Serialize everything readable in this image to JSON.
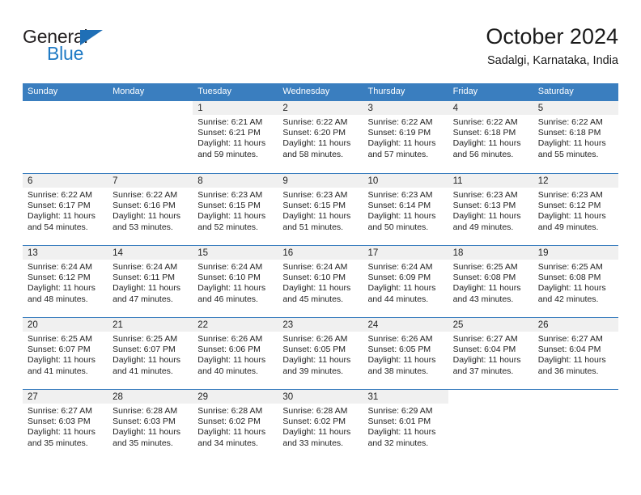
{
  "logo": {
    "word_top": "General",
    "word_bottom": "Blue",
    "triangle_icon": "triangle-icon",
    "color_dark": "#231f20",
    "color_blue": "#1f7ac4"
  },
  "header": {
    "title": "October 2024",
    "subtitle": "Sadalgi, Karnataka, India"
  },
  "theme": {
    "header_blue": "#3a7ebf",
    "daynum_gray": "#f0f0f0",
    "text": "#222222"
  },
  "calendar": {
    "weekdays": [
      "Sunday",
      "Monday",
      "Tuesday",
      "Wednesday",
      "Thursday",
      "Friday",
      "Saturday"
    ],
    "weeks": [
      [
        {
          "day": "",
          "sunrise": "",
          "sunset": "",
          "daylight1": "",
          "daylight2": "",
          "blank": true
        },
        {
          "day": "",
          "sunrise": "",
          "sunset": "",
          "daylight1": "",
          "daylight2": "",
          "blank": true
        },
        {
          "day": "1",
          "sunrise": "Sunrise: 6:21 AM",
          "sunset": "Sunset: 6:21 PM",
          "daylight1": "Daylight: 11 hours",
          "daylight2": "and 59 minutes."
        },
        {
          "day": "2",
          "sunrise": "Sunrise: 6:22 AM",
          "sunset": "Sunset: 6:20 PM",
          "daylight1": "Daylight: 11 hours",
          "daylight2": "and 58 minutes."
        },
        {
          "day": "3",
          "sunrise": "Sunrise: 6:22 AM",
          "sunset": "Sunset: 6:19 PM",
          "daylight1": "Daylight: 11 hours",
          "daylight2": "and 57 minutes."
        },
        {
          "day": "4",
          "sunrise": "Sunrise: 6:22 AM",
          "sunset": "Sunset: 6:18 PM",
          "daylight1": "Daylight: 11 hours",
          "daylight2": "and 56 minutes."
        },
        {
          "day": "5",
          "sunrise": "Sunrise: 6:22 AM",
          "sunset": "Sunset: 6:18 PM",
          "daylight1": "Daylight: 11 hours",
          "daylight2": "and 55 minutes."
        }
      ],
      [
        {
          "day": "6",
          "sunrise": "Sunrise: 6:22 AM",
          "sunset": "Sunset: 6:17 PM",
          "daylight1": "Daylight: 11 hours",
          "daylight2": "and 54 minutes."
        },
        {
          "day": "7",
          "sunrise": "Sunrise: 6:22 AM",
          "sunset": "Sunset: 6:16 PM",
          "daylight1": "Daylight: 11 hours",
          "daylight2": "and 53 minutes."
        },
        {
          "day": "8",
          "sunrise": "Sunrise: 6:23 AM",
          "sunset": "Sunset: 6:15 PM",
          "daylight1": "Daylight: 11 hours",
          "daylight2": "and 52 minutes."
        },
        {
          "day": "9",
          "sunrise": "Sunrise: 6:23 AM",
          "sunset": "Sunset: 6:15 PM",
          "daylight1": "Daylight: 11 hours",
          "daylight2": "and 51 minutes."
        },
        {
          "day": "10",
          "sunrise": "Sunrise: 6:23 AM",
          "sunset": "Sunset: 6:14 PM",
          "daylight1": "Daylight: 11 hours",
          "daylight2": "and 50 minutes."
        },
        {
          "day": "11",
          "sunrise": "Sunrise: 6:23 AM",
          "sunset": "Sunset: 6:13 PM",
          "daylight1": "Daylight: 11 hours",
          "daylight2": "and 49 minutes."
        },
        {
          "day": "12",
          "sunrise": "Sunrise: 6:23 AM",
          "sunset": "Sunset: 6:12 PM",
          "daylight1": "Daylight: 11 hours",
          "daylight2": "and 49 minutes."
        }
      ],
      [
        {
          "day": "13",
          "sunrise": "Sunrise: 6:24 AM",
          "sunset": "Sunset: 6:12 PM",
          "daylight1": "Daylight: 11 hours",
          "daylight2": "and 48 minutes."
        },
        {
          "day": "14",
          "sunrise": "Sunrise: 6:24 AM",
          "sunset": "Sunset: 6:11 PM",
          "daylight1": "Daylight: 11 hours",
          "daylight2": "and 47 minutes."
        },
        {
          "day": "15",
          "sunrise": "Sunrise: 6:24 AM",
          "sunset": "Sunset: 6:10 PM",
          "daylight1": "Daylight: 11 hours",
          "daylight2": "and 46 minutes."
        },
        {
          "day": "16",
          "sunrise": "Sunrise: 6:24 AM",
          "sunset": "Sunset: 6:10 PM",
          "daylight1": "Daylight: 11 hours",
          "daylight2": "and 45 minutes."
        },
        {
          "day": "17",
          "sunrise": "Sunrise: 6:24 AM",
          "sunset": "Sunset: 6:09 PM",
          "daylight1": "Daylight: 11 hours",
          "daylight2": "and 44 minutes."
        },
        {
          "day": "18",
          "sunrise": "Sunrise: 6:25 AM",
          "sunset": "Sunset: 6:08 PM",
          "daylight1": "Daylight: 11 hours",
          "daylight2": "and 43 minutes."
        },
        {
          "day": "19",
          "sunrise": "Sunrise: 6:25 AM",
          "sunset": "Sunset: 6:08 PM",
          "daylight1": "Daylight: 11 hours",
          "daylight2": "and 42 minutes."
        }
      ],
      [
        {
          "day": "20",
          "sunrise": "Sunrise: 6:25 AM",
          "sunset": "Sunset: 6:07 PM",
          "daylight1": "Daylight: 11 hours",
          "daylight2": "and 41 minutes."
        },
        {
          "day": "21",
          "sunrise": "Sunrise: 6:25 AM",
          "sunset": "Sunset: 6:07 PM",
          "daylight1": "Daylight: 11 hours",
          "daylight2": "and 41 minutes."
        },
        {
          "day": "22",
          "sunrise": "Sunrise: 6:26 AM",
          "sunset": "Sunset: 6:06 PM",
          "daylight1": "Daylight: 11 hours",
          "daylight2": "and 40 minutes."
        },
        {
          "day": "23",
          "sunrise": "Sunrise: 6:26 AM",
          "sunset": "Sunset: 6:05 PM",
          "daylight1": "Daylight: 11 hours",
          "daylight2": "and 39 minutes."
        },
        {
          "day": "24",
          "sunrise": "Sunrise: 6:26 AM",
          "sunset": "Sunset: 6:05 PM",
          "daylight1": "Daylight: 11 hours",
          "daylight2": "and 38 minutes."
        },
        {
          "day": "25",
          "sunrise": "Sunrise: 6:27 AM",
          "sunset": "Sunset: 6:04 PM",
          "daylight1": "Daylight: 11 hours",
          "daylight2": "and 37 minutes."
        },
        {
          "day": "26",
          "sunrise": "Sunrise: 6:27 AM",
          "sunset": "Sunset: 6:04 PM",
          "daylight1": "Daylight: 11 hours",
          "daylight2": "and 36 minutes."
        }
      ],
      [
        {
          "day": "27",
          "sunrise": "Sunrise: 6:27 AM",
          "sunset": "Sunset: 6:03 PM",
          "daylight1": "Daylight: 11 hours",
          "daylight2": "and 35 minutes."
        },
        {
          "day": "28",
          "sunrise": "Sunrise: 6:28 AM",
          "sunset": "Sunset: 6:03 PM",
          "daylight1": "Daylight: 11 hours",
          "daylight2": "and 35 minutes."
        },
        {
          "day": "29",
          "sunrise": "Sunrise: 6:28 AM",
          "sunset": "Sunset: 6:02 PM",
          "daylight1": "Daylight: 11 hours",
          "daylight2": "and 34 minutes."
        },
        {
          "day": "30",
          "sunrise": "Sunrise: 6:28 AM",
          "sunset": "Sunset: 6:02 PM",
          "daylight1": "Daylight: 11 hours",
          "daylight2": "and 33 minutes."
        },
        {
          "day": "31",
          "sunrise": "Sunrise: 6:29 AM",
          "sunset": "Sunset: 6:01 PM",
          "daylight1": "Daylight: 11 hours",
          "daylight2": "and 32 minutes."
        },
        {
          "day": "",
          "sunrise": "",
          "sunset": "",
          "daylight1": "",
          "daylight2": "",
          "blank": true
        },
        {
          "day": "",
          "sunrise": "",
          "sunset": "",
          "daylight1": "",
          "daylight2": "",
          "blank": true
        }
      ]
    ]
  }
}
